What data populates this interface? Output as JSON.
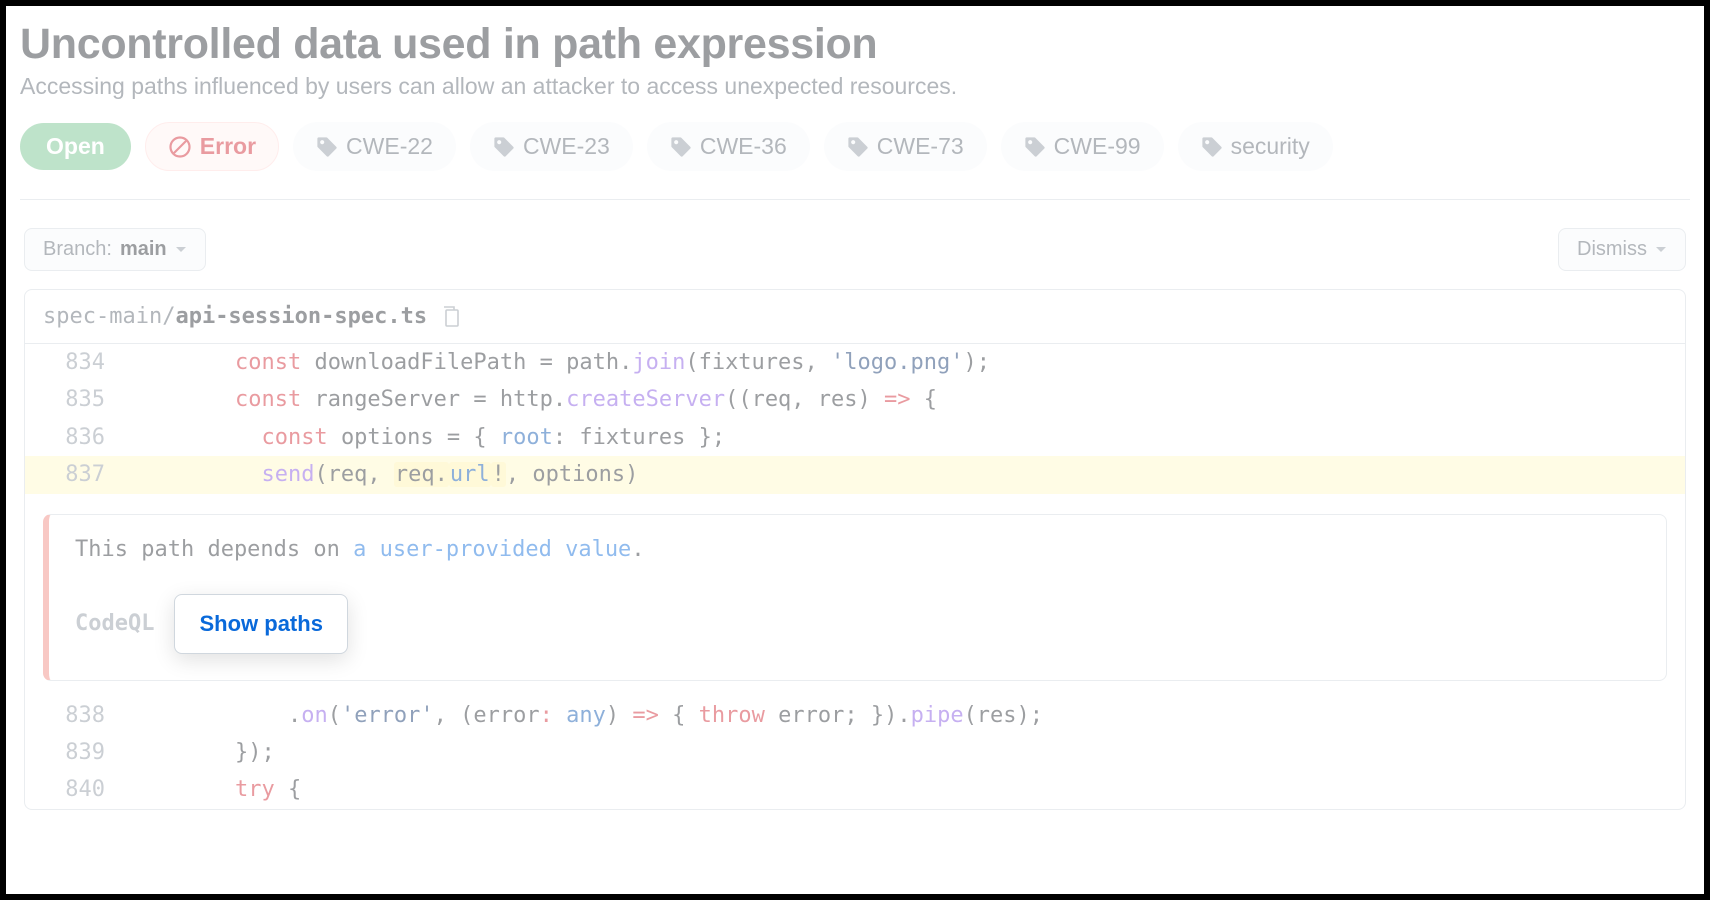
{
  "header": {
    "title": "Uncontrolled data used in path expression",
    "subtitle": "Accessing paths influenced by users can allow an attacker to access unexpected resources."
  },
  "pills": {
    "open": "Open",
    "error": "Error",
    "tags": [
      "CWE-22",
      "CWE-23",
      "CWE-36",
      "CWE-73",
      "CWE-99",
      "security"
    ]
  },
  "toolbar": {
    "branch_prefix": "Branch: ",
    "branch_name": "main",
    "dismiss": "Dismiss"
  },
  "file": {
    "dir": "spec-main/",
    "name": "api-session-spec.ts"
  },
  "code": {
    "lines": [
      {
        "n": "834",
        "indent": "        ",
        "tokens": [
          {
            "t": "const ",
            "c": "tk-k"
          },
          {
            "t": "downloadFilePath = path."
          },
          {
            "t": "join",
            "c": "tk-fn"
          },
          {
            "t": "(fixtures, "
          },
          {
            "t": "'logo.png'",
            "c": "tk-s"
          },
          {
            "t": ");"
          }
        ]
      },
      {
        "n": "835",
        "indent": "        ",
        "tokens": [
          {
            "t": "const ",
            "c": "tk-k"
          },
          {
            "t": "rangeServer = http."
          },
          {
            "t": "createServer",
            "c": "tk-fn"
          },
          {
            "t": "((req, res) "
          },
          {
            "t": "=>",
            "c": "tk-k"
          },
          {
            "t": " {"
          }
        ]
      },
      {
        "n": "836",
        "indent": "          ",
        "tokens": [
          {
            "t": "const ",
            "c": "tk-k"
          },
          {
            "t": "options = { "
          },
          {
            "t": "root",
            "c": "tk-p"
          },
          {
            "t": ": fixtures };"
          }
        ]
      },
      {
        "n": "837",
        "hl": true,
        "indent": "          ",
        "tokens": [
          {
            "t": "send",
            "c": "tk-fn"
          },
          {
            "t": "(req, "
          },
          {
            "t": "req.",
            "hl": true
          },
          {
            "t": "url",
            "c": "tk-p",
            "hl": true
          },
          {
            "t": "!",
            "hl": true
          },
          {
            "t": ", options)"
          }
        ]
      }
    ],
    "lines_after": [
      {
        "n": "838",
        "indent": "            ",
        "tokens": [
          {
            "t": "."
          },
          {
            "t": "on",
            "c": "tk-fn"
          },
          {
            "t": "("
          },
          {
            "t": "'error'",
            "c": "tk-s"
          },
          {
            "t": ", (error"
          },
          {
            "t": ": ",
            "c": "tk-k"
          },
          {
            "t": "any",
            "c": "tk-p"
          },
          {
            "t": ") "
          },
          {
            "t": "=>",
            "c": "tk-k"
          },
          {
            "t": " { "
          },
          {
            "t": "throw",
            "c": "tk-k"
          },
          {
            "t": " error; })."
          },
          {
            "t": "pipe",
            "c": "tk-fn"
          },
          {
            "t": "(res);"
          }
        ]
      },
      {
        "n": "839",
        "indent": "        ",
        "tokens": [
          {
            "t": "});"
          }
        ]
      },
      {
        "n": "840",
        "indent": "        ",
        "tokens": [
          {
            "t": "try",
            "c": "tk-k"
          },
          {
            "t": " {"
          }
        ]
      }
    ]
  },
  "alert": {
    "msg_pre": "This path depends on ",
    "msg_link": "a user-provided value",
    "msg_post": ".",
    "codeql": "CodeQL",
    "show_paths": "Show paths"
  }
}
